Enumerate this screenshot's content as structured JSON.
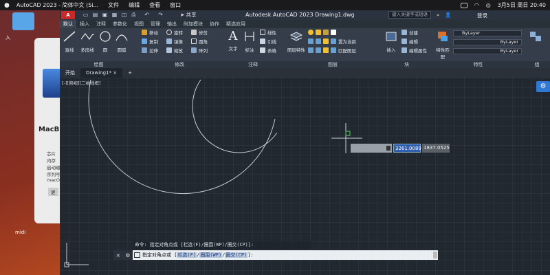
{
  "menubar": {
    "app": "AutoCAD 2023 - 简体中文 (Si...",
    "items": [
      "文件",
      "编辑",
      "查看",
      "窗口"
    ],
    "date_time": "3月5日 周日  20:40"
  },
  "desktop": {
    "folder_label": "入",
    "file_label": "midi"
  },
  "about_mac": {
    "title": "MacB",
    "specs": [
      "芯片",
      "内存",
      "启动磁盘",
      "序列号",
      "macOS"
    ],
    "more_button": "更"
  },
  "acad": {
    "logo": "A CAD",
    "share": "共享",
    "title": "Autodesk AutoCAD 2023    Drawing1.dwg",
    "search_placeholder": "键入关键字或短语",
    "user": "登录",
    "ribbon_tabs": [
      "默认",
      "插入",
      "注释",
      "参数化",
      "视图",
      "管理",
      "输出",
      "附加模块",
      "协作",
      "精选应用"
    ],
    "panels": {
      "draw": {
        "title": "绘图",
        "buttons": [
          "直线",
          "多段线",
          "圆",
          "圆弧"
        ]
      },
      "modify": {
        "title": "修改",
        "rows": [
          [
            "移动",
            "旋转",
            "修剪"
          ],
          [
            "复制",
            "镜像",
            "圆角"
          ],
          [
            "拉伸",
            "缩放",
            "阵列"
          ]
        ]
      },
      "annotation": {
        "title": "注释",
        "buttons": [
          "文字",
          "标注"
        ],
        "rows": [
          "线性",
          "引线",
          "表格"
        ]
      },
      "layers": {
        "title": "图层",
        "buttons": [
          "图层特性"
        ],
        "rows": [
          "置为当前",
          "匹配图层"
        ]
      },
      "block": {
        "title": "块",
        "buttons": [
          "插入"
        ],
        "rows": [
          "创建",
          "编辑",
          "编辑属性"
        ]
      },
      "properties": {
        "title": "特性",
        "buttons": [
          "特性匹配"
        ],
        "fields": [
          "ByLayer",
          "ByLayer",
          "ByLayer"
        ]
      },
      "group": {
        "title": "组"
      }
    },
    "doc_tabs": [
      "开始",
      "Drawing1*"
    ],
    "view_label": "[-][俯视][二维线框]",
    "coord_x": "3261.0089",
    "coord_y": "1837.0525",
    "command_history": "命令: 指定对角点或 [栏选(F)/圈围(WP)/圈交(CP)]:",
    "command_prompt": "指定对角点或 [",
    "command_options": [
      "栏选(F)",
      "圈围(WP)",
      "圈交(CP)"
    ],
    "command_suffix": "]:"
  }
}
